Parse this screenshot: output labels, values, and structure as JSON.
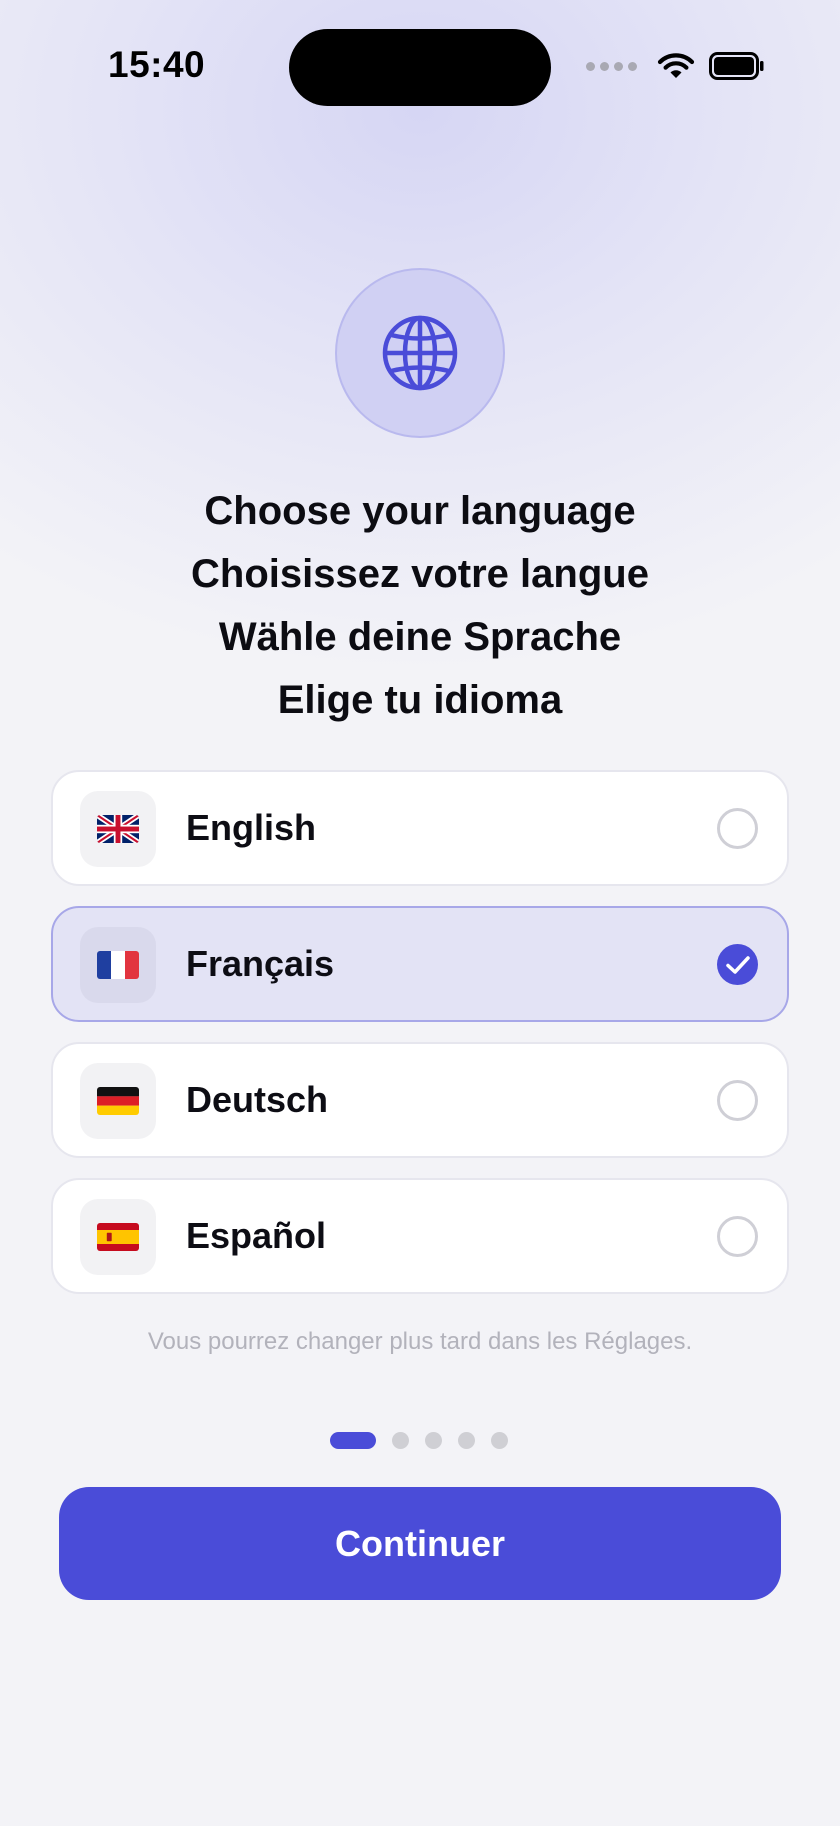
{
  "status_bar": {
    "time": "15:40",
    "icons": [
      "signal-dots-icon",
      "wifi-icon",
      "battery-icon"
    ]
  },
  "header": {
    "icon": "globe-icon",
    "titles": [
      "Choose your language",
      "Choisissez votre langue",
      "Wähle deine Sprache",
      "Elige tu idioma"
    ]
  },
  "languages": [
    {
      "label": "English",
      "flag": "uk-flag-icon",
      "selected": false
    },
    {
      "label": "Français",
      "flag": "france-flag-icon",
      "selected": true
    },
    {
      "label": "Deutsch",
      "flag": "germany-flag-icon",
      "selected": false
    },
    {
      "label": "Español",
      "flag": "spain-flag-icon",
      "selected": false
    }
  ],
  "note": "Vous pourrez changer plus tard dans les Réglages.",
  "pager": {
    "total": 5,
    "current": 1
  },
  "primary_button": {
    "label": "Continuer"
  },
  "colors": {
    "accent": "#4A4CD8",
    "selected_bg": "#E3E3F5",
    "selected_border": "#A7A7E8",
    "badge_bg": "#D0D0F3"
  }
}
